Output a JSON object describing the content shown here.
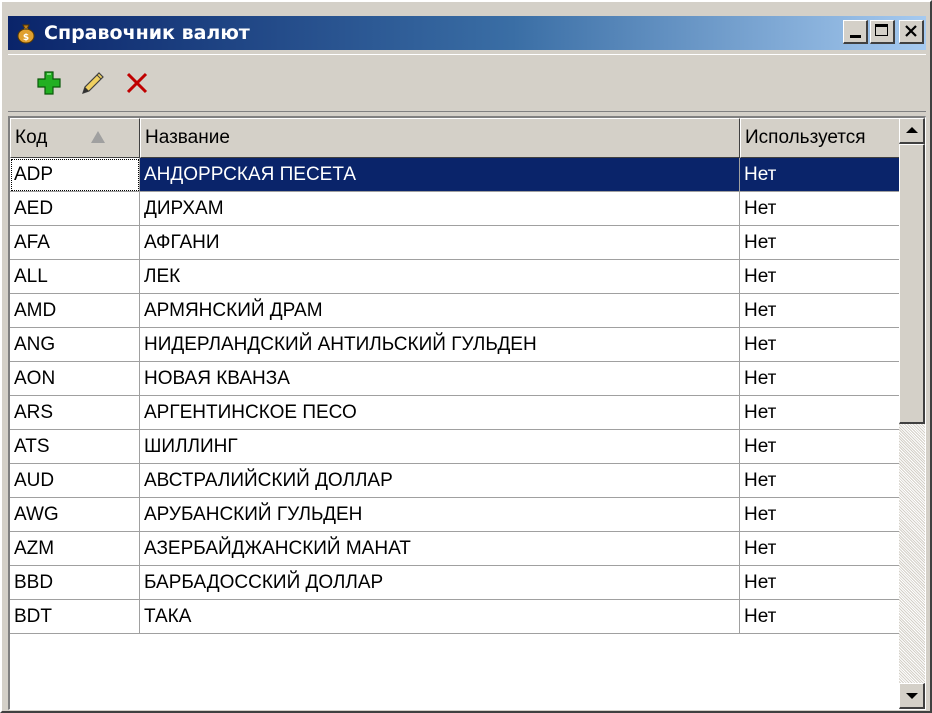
{
  "window": {
    "title": "Справочник валют",
    "icon": "money-bag-icon",
    "buttons": {
      "minimize": "minimize-icon",
      "maximize": "maximize-icon",
      "close": "close-icon"
    }
  },
  "toolbar": {
    "add_icon": "plus-icon",
    "edit_icon": "pencil-icon",
    "delete_icon": "x-icon",
    "colors": {
      "add": "#00a000",
      "delete": "#c00000"
    }
  },
  "table": {
    "columns": [
      {
        "label": "Код",
        "sorted": "ascending"
      },
      {
        "label": "Название"
      },
      {
        "label": "Используется"
      }
    ],
    "selected_row": 0,
    "rows": [
      {
        "code": "ADP",
        "name": "АНДОРРСКАЯ ПЕСЕТА",
        "used": "Нет"
      },
      {
        "code": "AED",
        "name": "ДИРХАМ",
        "used": "Нет"
      },
      {
        "code": "AFA",
        "name": "АФГАНИ",
        "used": "Нет"
      },
      {
        "code": "ALL",
        "name": "ЛЕК",
        "used": "Нет"
      },
      {
        "code": "AMD",
        "name": "АРМЯНСКИЙ ДРАМ",
        "used": "Нет"
      },
      {
        "code": "ANG",
        "name": "НИДЕРЛАНДСКИЙ АНТИЛЬСКИЙ ГУЛЬДЕН",
        "used": "Нет"
      },
      {
        "code": "AON",
        "name": "НОВАЯ КВАНЗА",
        "used": "Нет"
      },
      {
        "code": "ARS",
        "name": "АРГЕНТИНСКОЕ ПЕСО",
        "used": "Нет"
      },
      {
        "code": "ATS",
        "name": "ШИЛЛИНГ",
        "used": "Нет"
      },
      {
        "code": "AUD",
        "name": "АВСТРАЛИЙСКИЙ ДОЛЛАР",
        "used": "Нет"
      },
      {
        "code": "AWG",
        "name": "АРУБАНСКИЙ ГУЛЬДЕН",
        "used": "Нет"
      },
      {
        "code": "AZM",
        "name": "АЗЕРБАЙДЖАНСКИЙ МАНАТ",
        "used": "Нет"
      },
      {
        "code": "BBD",
        "name": "БАРБАДОССКИЙ ДОЛЛАР",
        "used": "Нет"
      },
      {
        "code": "BDT",
        "name": "ТАКА",
        "used": "Нет"
      }
    ]
  },
  "colors": {
    "title_start": "#0a246a",
    "title_end": "#a6caf0",
    "selection": "#0a246a",
    "face": "#d4d0c8"
  }
}
